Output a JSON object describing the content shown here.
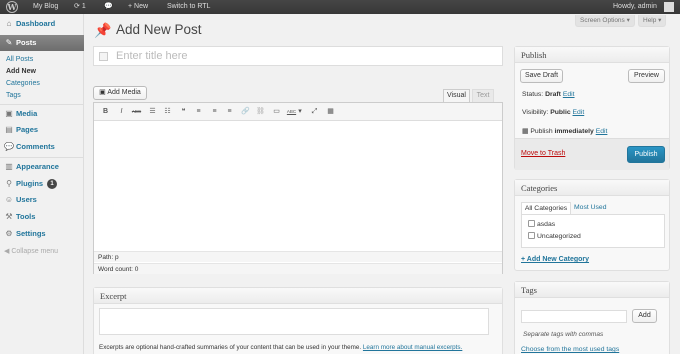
{
  "adminbar": {
    "site_name": "My Blog",
    "updates_count": "1",
    "new_label": "New",
    "rtl_label": "Switch to RTL",
    "howdy": "Howdy, admin"
  },
  "screen_options": {
    "screen_options_label": "Screen Options ▾",
    "help_label": "Help ▾"
  },
  "sidebar": {
    "dashboard": "Dashboard",
    "posts": "Posts",
    "posts_sub": [
      "All Posts",
      "Add New",
      "Categories",
      "Tags"
    ],
    "media": "Media",
    "pages": "Pages",
    "comments": "Comments",
    "appearance": "Appearance",
    "plugins": "Plugins",
    "plugins_badge": "1",
    "users": "Users",
    "tools": "Tools",
    "settings": "Settings",
    "collapse": "Collapse menu"
  },
  "page": {
    "title": "Add New Post",
    "title_placeholder": "Enter title here"
  },
  "editor": {
    "add_media": "Add Media",
    "tab_visual": "Visual",
    "tab_text": "Text",
    "toolbar_buttons": [
      "B",
      "I",
      "ABC",
      "☰",
      "☷",
      "❝",
      "≡",
      "≡",
      "≡",
      "🔗",
      "⛓",
      "▭",
      "ABC",
      "▾",
      "⤢",
      "▦"
    ],
    "path": "Path: p",
    "word_count": "Word count: 0"
  },
  "excerpt": {
    "title": "Excerpt",
    "note": "Excerpts are optional hand-crafted summaries of your content that can be used in your theme.",
    "learn_more": "Learn more about manual excerpts."
  },
  "publish": {
    "title": "Publish",
    "save_draft": "Save Draft",
    "preview": "Preview",
    "status_label": "Status:",
    "status_value": "Draft",
    "visibility_label": "Visibility:",
    "visibility_value": "Public",
    "schedule_label": "Publish",
    "schedule_value": "immediately",
    "edit": "Edit",
    "move_to_trash": "Move to Trash",
    "publish_button": "Publish"
  },
  "categories": {
    "title": "Categories",
    "tab_all": "All Categories",
    "tab_used": "Most Used",
    "items": [
      "asdas",
      "Uncategorized"
    ],
    "add_new": "+ Add New Category"
  },
  "tags": {
    "title": "Tags",
    "add_button": "Add",
    "separator_note": "Separate tags with commas",
    "choose_link": "Choose from the most used tags"
  }
}
